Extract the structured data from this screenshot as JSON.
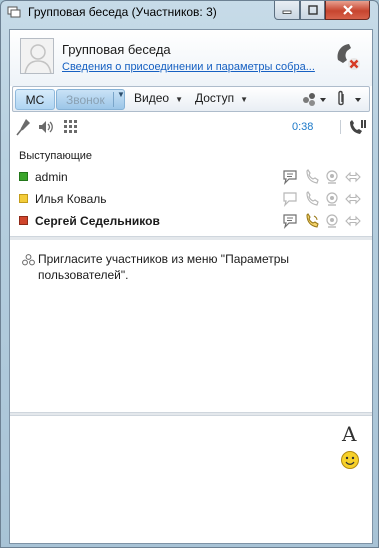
{
  "window": {
    "title": "Групповая беседа (Участников: 3)"
  },
  "header": {
    "title": "Групповая беседа",
    "join_link": "Сведения о присоединении и параметры собра..."
  },
  "toolbar": {
    "mc_label": "МС",
    "call_label": "Звонок",
    "video_label": "Видео",
    "access_label": "Доступ"
  },
  "status": {
    "timer": "0:38"
  },
  "participants": {
    "section_label": "Выступающие",
    "items": [
      {
        "name": "admin",
        "color": "#3aa52b",
        "bold": false
      },
      {
        "name": "Илья Коваль",
        "color": "#f3cc3a",
        "bold": false
      },
      {
        "name": "Сергей Седельников",
        "color": "#d0452c",
        "bold": true
      }
    ]
  },
  "chat": {
    "system_message": "Пригласите участников из меню \"Параметры пользователей\"."
  },
  "compose": {
    "font_button": "A"
  }
}
